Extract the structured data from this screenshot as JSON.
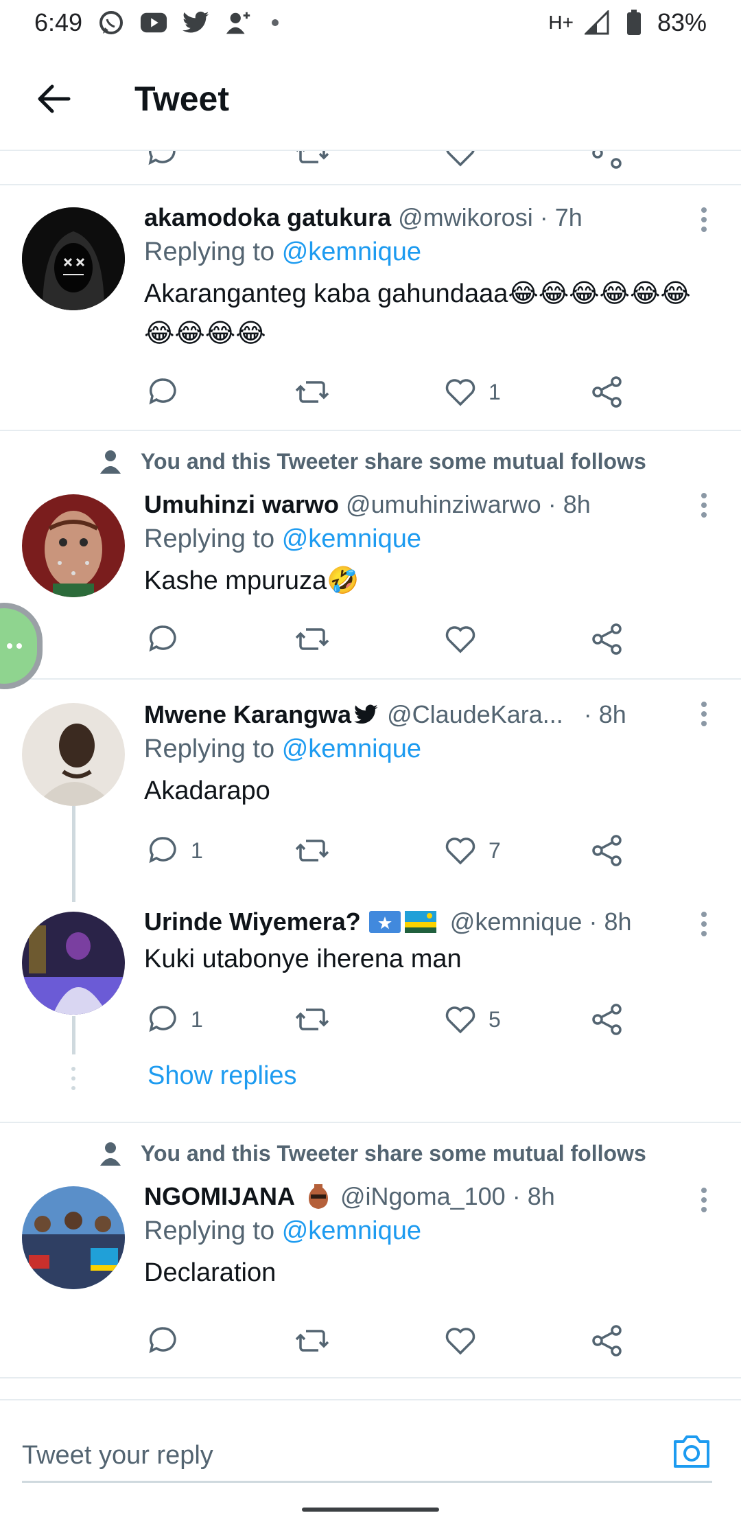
{
  "status_bar": {
    "time": "6:49",
    "network": "H+",
    "battery": "83%"
  },
  "header": {
    "title": "Tweet"
  },
  "reply_prefix": "Replying to",
  "mutual_text": "You and this Tweeter share some mutual follows",
  "tweets": [
    {
      "name": "akamodoka gatukura",
      "handle": "@mwikorosi",
      "time": "· 7h",
      "replying_to": "@kemnique",
      "text": "Akaranganteg kaba gahundaaa😂😂😂😂😂😂😂😂😂😂",
      "replies": "",
      "retweets": "",
      "likes": "1"
    },
    {
      "name": "Umuhinzi warwo",
      "handle": "@umuhinziwarwo",
      "time": "· 8h",
      "replying_to": "@kemnique",
      "text": "Kashe mpuruza🤣",
      "replies": "",
      "retweets": "",
      "likes": ""
    },
    {
      "name": "Mwene Karangwa",
      "handle": "@ClaudeKara...",
      "time": "· 8h",
      "replying_to": "@kemnique",
      "text": "Akadarapo",
      "replies": "1",
      "retweets": "",
      "likes": "7"
    },
    {
      "name": "Urinde Wiyemera?",
      "handle": "@kemnique",
      "time": "· 8h",
      "text": "Kuki utabonye iherena man",
      "replies": "1",
      "retweets": "",
      "likes": "5"
    },
    {
      "name": "NGOMIJANA",
      "handle": "@iNgoma_100",
      "time": "· 8h",
      "replying_to": "@kemnique",
      "text": "Declaration",
      "replies": "",
      "retweets": "",
      "likes": ""
    }
  ],
  "show_replies": "Show replies",
  "compose": {
    "placeholder": "Tweet your reply"
  },
  "colors": {
    "accent": "#1d9bf0",
    "secondary_text": "#536471",
    "divider": "#e6ecf0"
  }
}
